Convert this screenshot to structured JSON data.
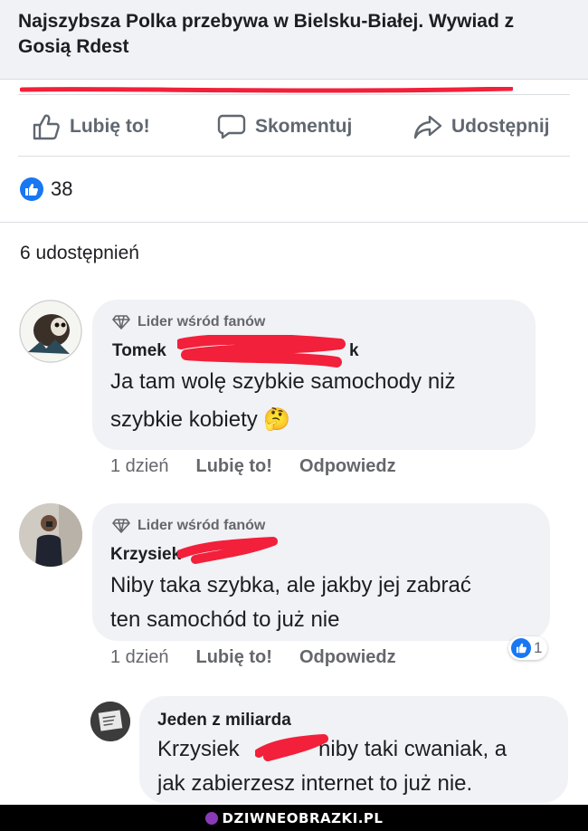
{
  "post": {
    "link_title": "Najszybsza Polka przebywa w Bielsku-Białej. Wywiad z Gosią Rdest",
    "actions": {
      "like_label": "Lubię to!",
      "comment_label": "Skomentuj",
      "share_label": "Udostępnij"
    },
    "reaction_count": "38",
    "shares_text": "6 udostępnień"
  },
  "comments": [
    {
      "badge": "Lider wśród fanów",
      "author": "Tomek",
      "author_tail": "k",
      "lines": [
        "Ja tam wolę szybkie samochody niż",
        "szybkie kobiety 🤔"
      ],
      "time": "1 dzień",
      "like": "Lubię to!",
      "reply": "Odpowiedz"
    },
    {
      "badge": "Lider wśród fanów",
      "author": "Krzysiek",
      "lines": [
        "Niby taka szybka, ale jakby jej zabrać",
        "ten samochód to już nie"
      ],
      "time": "1 dzień",
      "like": "Lubię to!",
      "reply": "Odpowiedz",
      "reactions": "1"
    },
    {
      "author": "Jeden z miliarda",
      "lines_a": "Krzysiek",
      "lines_b": "niby taki cwaniak, a",
      "line2": "jak zabierzesz internet to już nie."
    }
  ],
  "watermark": "DZIWNEOBRAZKI.PL",
  "colors": {
    "accent": "#1877f2",
    "redaction": "#f2203a",
    "bubble": "#f0f2f5"
  },
  "icons": [
    "thumbs-up-icon",
    "comment-icon",
    "share-icon",
    "diamond-icon",
    "like-badge-icon"
  ]
}
